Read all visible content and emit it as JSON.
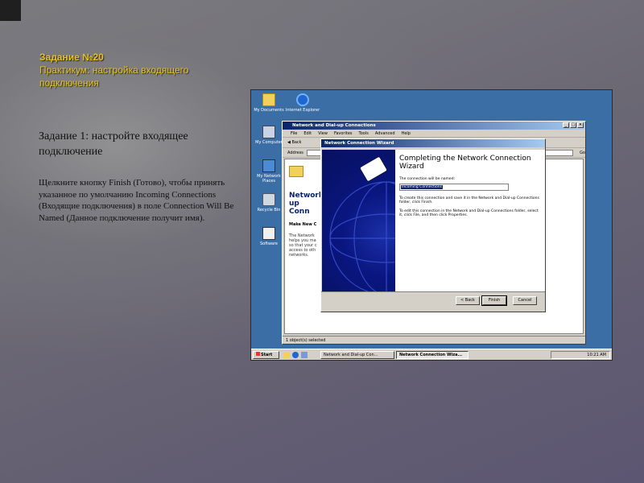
{
  "slide": {
    "title_line1": "Задание №20",
    "title_line2": "Практикум: настройка входящего подключения",
    "heading": "Задание 1: настройте входящее подключение",
    "body": "Щелкните кнопку Finish (Готово), чтобы принять указанное по умолчанию Incoming Connections (Входящие подключения) в поле Connection Will Be Named (Данное подключение получит имя)."
  },
  "desktop": {
    "icons": [
      {
        "label": "My Documents",
        "icon": "folder-icon"
      },
      {
        "label": "Internet Explorer",
        "icon": "ie-icon"
      },
      {
        "label": "My Computer",
        "icon": "computer-icon"
      },
      {
        "label": "My Network Places",
        "icon": "network-icon"
      },
      {
        "label": "Recycle Bin",
        "icon": "recycle-bin-icon"
      },
      {
        "label": "Software",
        "icon": "software-icon"
      }
    ]
  },
  "explorer": {
    "title": "Network and Dial-up Connections",
    "menu": [
      "File",
      "Edit",
      "View",
      "Favorites",
      "Tools",
      "Advanced",
      "Help"
    ],
    "back_label": "Back",
    "address_label": "Address",
    "go_label": "Go",
    "pane_title": "Network and Dial-up Connections",
    "pane_title_visible": "Network\nup Conn",
    "pane_subtitle": "Make New C",
    "pane_desc": "The Network helps you ma so that your c access to oth networks.",
    "status": "1 object(s) selected"
  },
  "wizard": {
    "title": "Network Connection Wizard",
    "heading": "Completing the Network Connection Wizard",
    "name_label": "The connection will be named:",
    "name_value": "Incoming Connections",
    "para1": "To create this connection and save it in the Network and Dial-up Connections folder, click Finish.",
    "para2": "To edit this connection in the Network and Dial-up Connections folder, select it, click File, and then click Properties.",
    "back_button": "< Back",
    "finish_button": "Finish",
    "cancel_button": "Cancel"
  },
  "taskbar": {
    "start_label": "Start",
    "task1": "Network and Dial-up Con...",
    "task2": "Network Connection Wiza...",
    "clock": "10:21 AM"
  },
  "colors": {
    "title_yellow": "#e8c21a",
    "desktop_blue": "#3a6ea5",
    "titlebar_navy": "#0a246a"
  }
}
